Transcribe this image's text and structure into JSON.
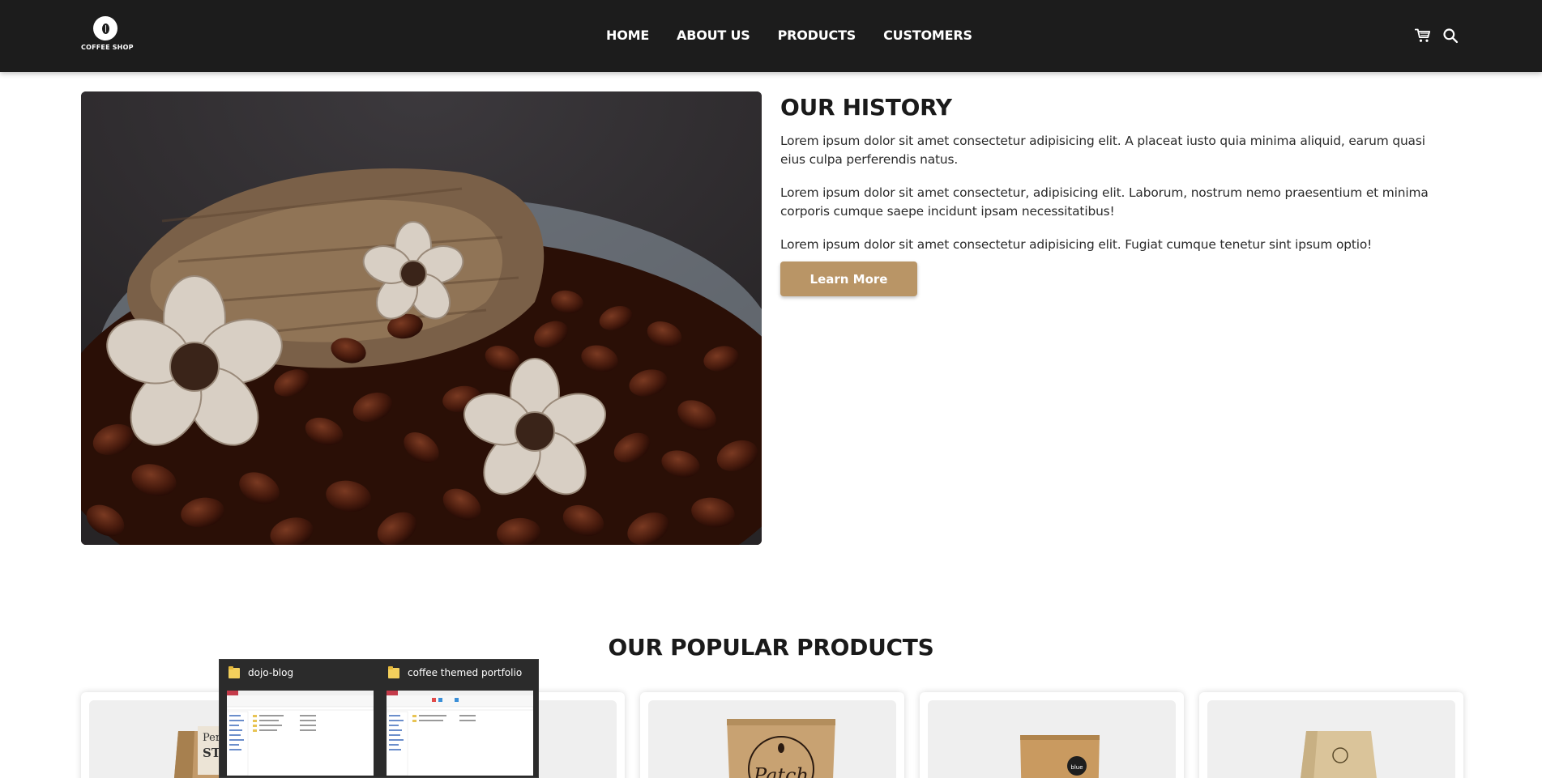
{
  "header": {
    "logo_text": "COFFEE SHOP",
    "nav": [
      "HOME",
      "ABOUT US",
      "PRODUCTS",
      "CUSTOMERS"
    ],
    "icons": [
      "cart-icon",
      "search-icon"
    ]
  },
  "history": {
    "title": "OUR HISTORY",
    "paragraphs": [
      "Lorem ipsum dolor sit amet consectetur adipisicing elit. A placeat iusto quia minima aliquid, earum quasi eius culpa perferendis natus.",
      "Lorem ipsum dolor sit amet consectetur, adipisicing elit. Laborum, nostrum nemo praesentium et minima corporis cumque saepe incidunt ipsam necessitatibus!",
      "Lorem ipsum dolor sit amet consectetur adipisicing elit. Fugiat cumque tenetur sint ipsum optio!"
    ],
    "button_label": "Learn More"
  },
  "products": {
    "title": "OUR POPULAR PRODUCTS"
  },
  "taskbar_preview": {
    "windows": [
      "dojo-blog",
      "coffee themed portfolio"
    ]
  },
  "colors": {
    "header_bg": "#1c1c1c",
    "accent": "#b99566",
    "card_bg": "#efefef"
  }
}
